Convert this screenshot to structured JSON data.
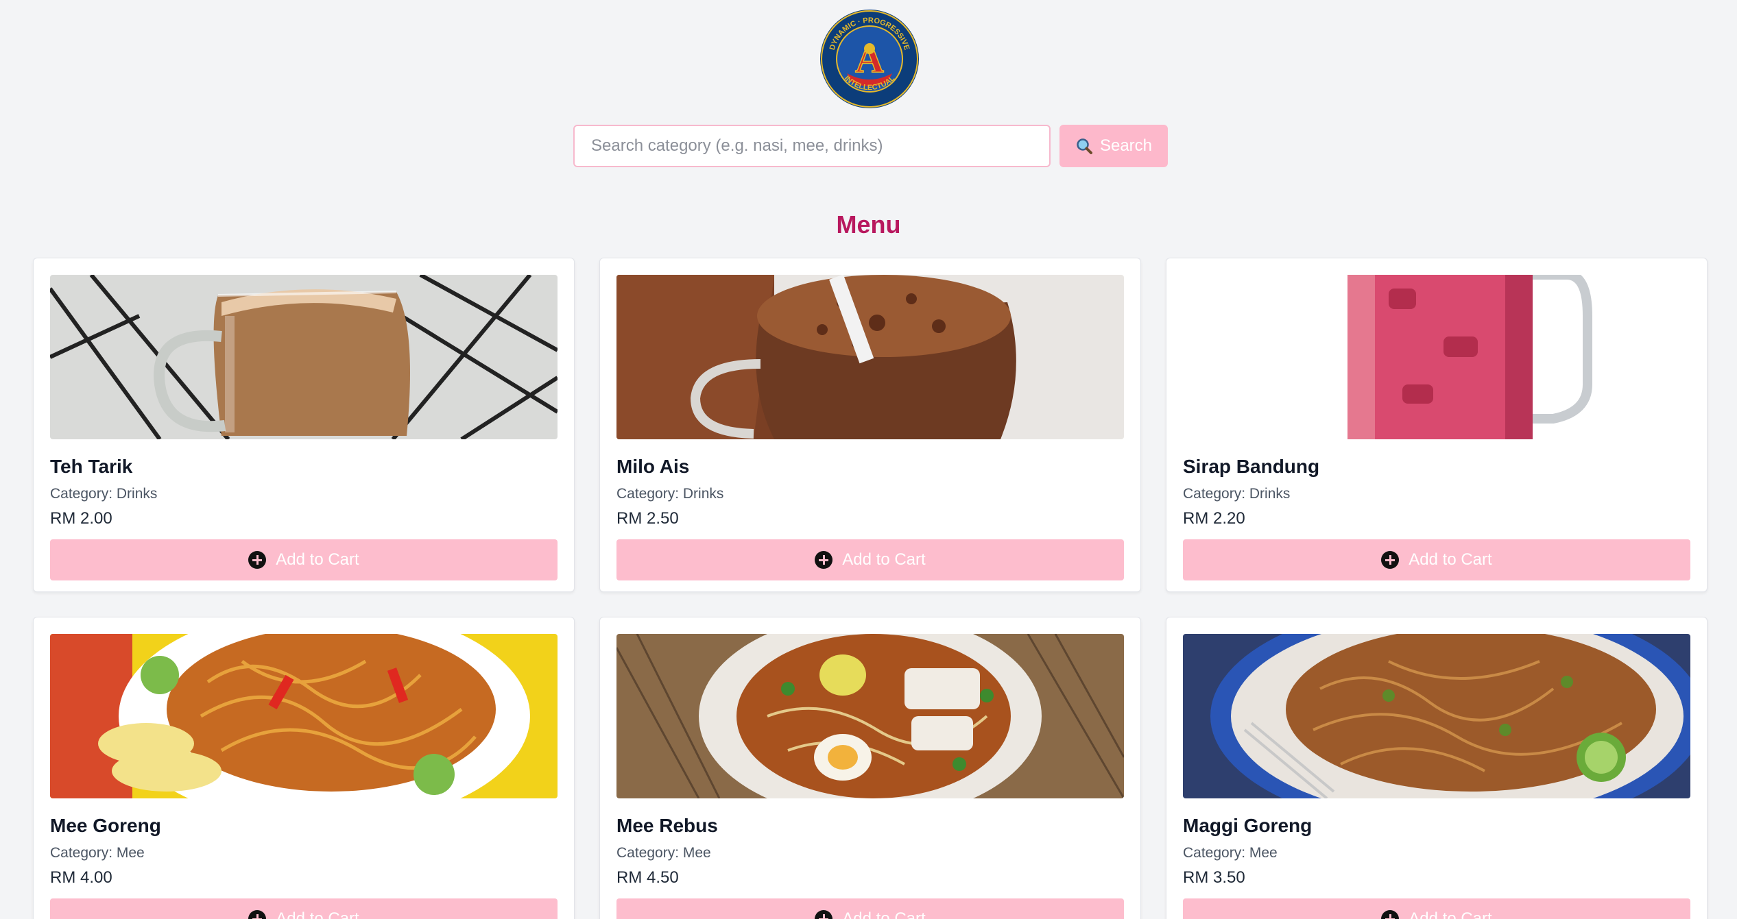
{
  "logo": {
    "top_text": "DYNAMIC · PROGRESSIVE",
    "bottom_text": "INTELLECTUAL",
    "center_letter": "A"
  },
  "search": {
    "placeholder": "Search category (e.g. nasi, mee, drinks)",
    "value": "",
    "button_label": "Search"
  },
  "menu": {
    "title": "Menu",
    "items": [
      {
        "name": "Teh Tarik",
        "category": "Category: Drinks",
        "price": "RM 2.00",
        "button": "Add to Cart",
        "image": "teh-tarik-photo"
      },
      {
        "name": "Milo Ais",
        "category": "Category: Drinks",
        "price": "RM 2.50",
        "button": "Add to Cart",
        "image": "milo-ais-photo"
      },
      {
        "name": "Sirap Bandung",
        "category": "Category: Drinks",
        "price": "RM 2.20",
        "button": "Add to Cart",
        "image": "sirap-bandung-photo"
      },
      {
        "name": "Mee Goreng",
        "category": "Category: Mee",
        "price": "RM 4.00",
        "button": "Add to Cart",
        "image": "mee-goreng-photo"
      },
      {
        "name": "Mee Rebus",
        "category": "Category: Mee",
        "price": "RM 4.50",
        "button": "Add to Cart",
        "image": "mee-rebus-photo"
      },
      {
        "name": "Maggi Goreng",
        "category": "Category: Mee",
        "price": "RM 3.50",
        "button": "Add to Cart",
        "image": "maggi-goreng-photo"
      }
    ]
  },
  "colors": {
    "accent": "#fdbdcd",
    "heading": "#b8185e",
    "background": "#f3f4f6"
  },
  "icons": {
    "search": "magnifier-icon",
    "add": "plus-circle-icon"
  }
}
